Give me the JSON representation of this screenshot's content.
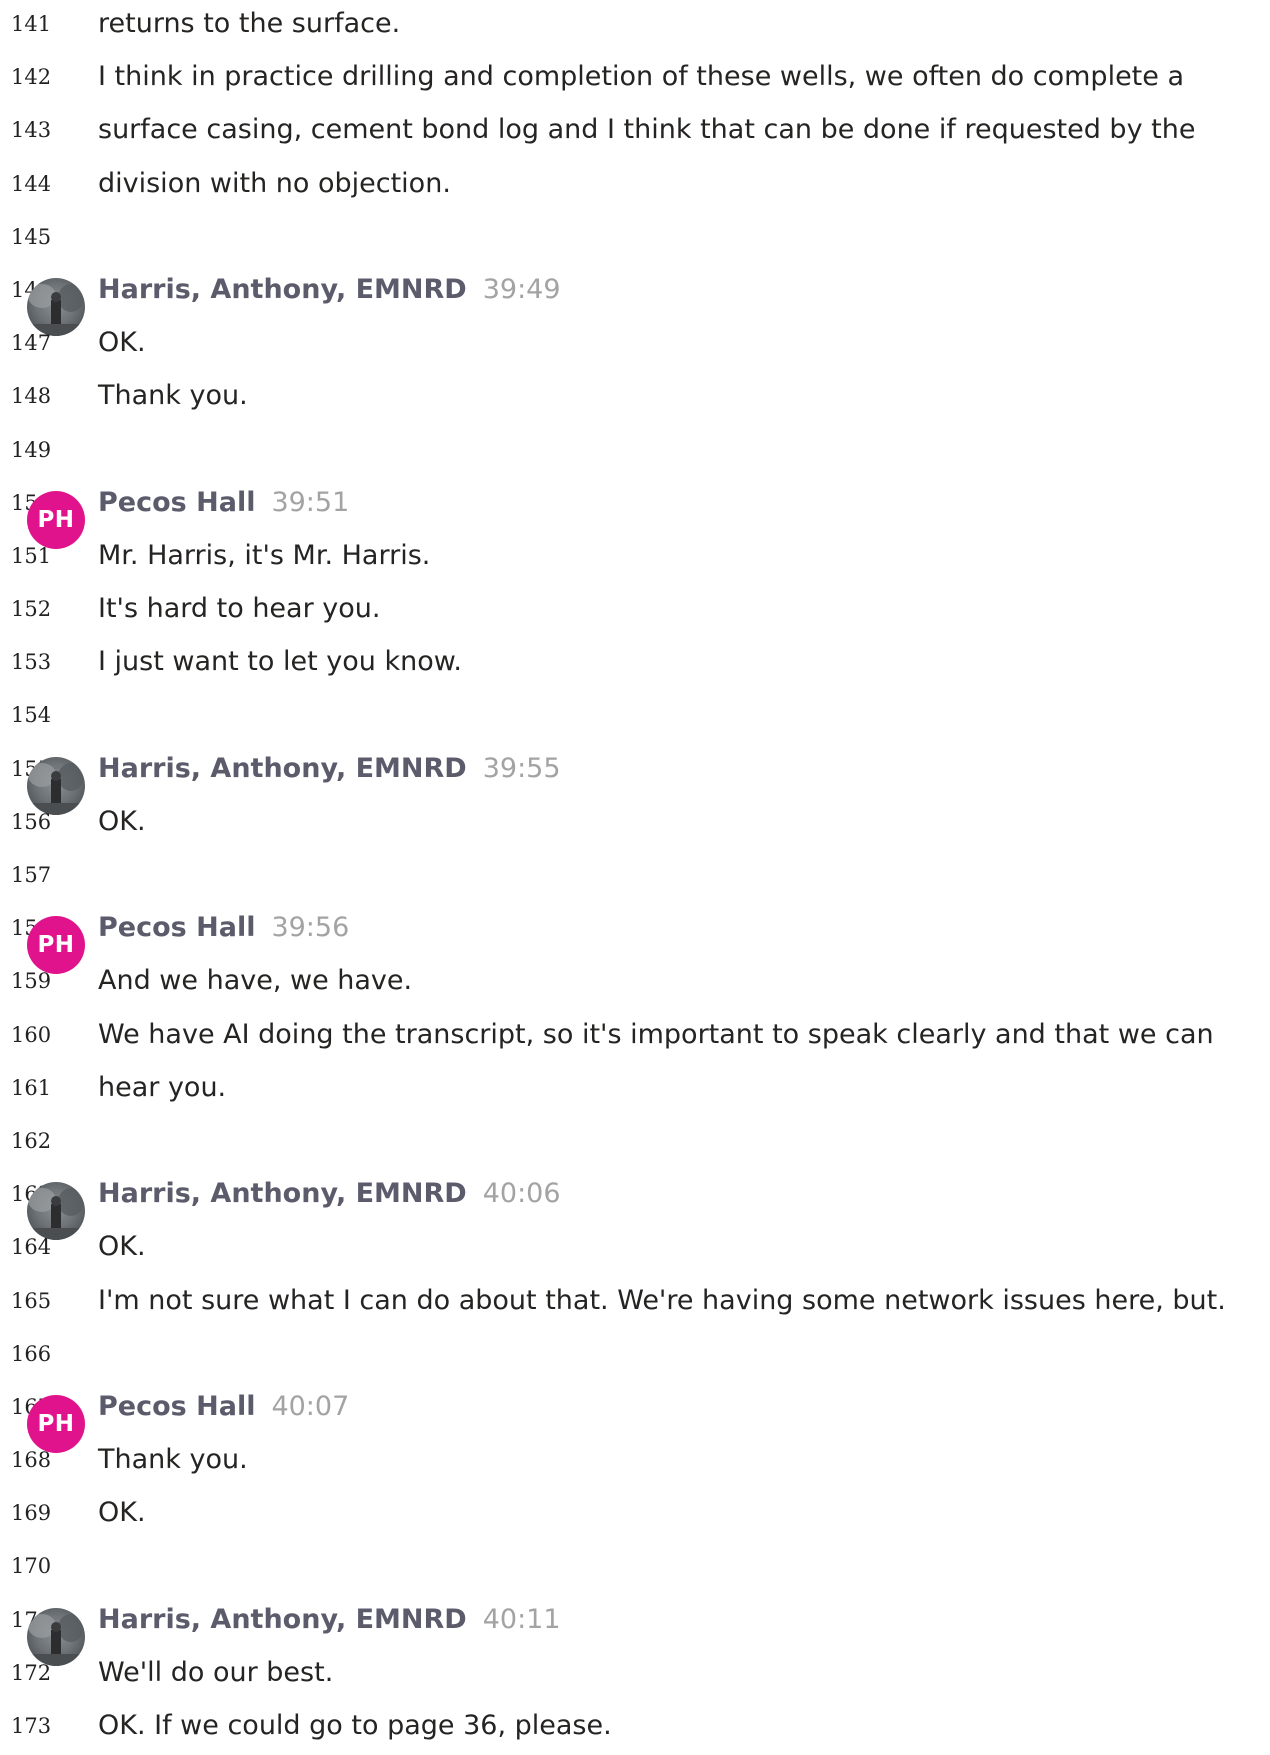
{
  "transcript": {
    "rows": [
      {
        "line": "141",
        "text": "returns to the surface."
      },
      {
        "line": "142",
        "text": "I think in practice drilling and completion of these wells, we often do complete a"
      },
      {
        "line": "143",
        "text": "surface casing, cement bond log and I think that can be done if requested by the"
      },
      {
        "line": "144",
        "text": "division with no objection."
      },
      {
        "line": "145",
        "text": ""
      },
      {
        "line": "146",
        "speaker": "Harris, Anthony, EMNRD",
        "time": "39:49",
        "avatar": "photo"
      },
      {
        "line": "147",
        "text": "OK."
      },
      {
        "line": "148",
        "text": "Thank you."
      },
      {
        "line": "149",
        "text": ""
      },
      {
        "line": "150",
        "speaker": "Pecos Hall",
        "time": "39:51",
        "avatar": "initials",
        "initials": "PH"
      },
      {
        "line": "151",
        "text": "Mr. Harris, it's Mr. Harris."
      },
      {
        "line": "152",
        "text": "It's hard to hear you."
      },
      {
        "line": "153",
        "text": "I just want to let you know."
      },
      {
        "line": "154",
        "text": ""
      },
      {
        "line": "155",
        "speaker": "Harris, Anthony, EMNRD",
        "time": "39:55",
        "avatar": "photo"
      },
      {
        "line": "156",
        "text": "OK."
      },
      {
        "line": "157",
        "text": ""
      },
      {
        "line": "158",
        "speaker": "Pecos Hall",
        "time": "39:56",
        "avatar": "initials",
        "initials": "PH"
      },
      {
        "line": "159",
        "text": "And we have, we have."
      },
      {
        "line": "160",
        "text": "We have AI doing the transcript, so it's important to speak clearly and that we can"
      },
      {
        "line": "161",
        "text": "hear you."
      },
      {
        "line": "162",
        "text": ""
      },
      {
        "line": "163",
        "speaker": "Harris, Anthony, EMNRD",
        "time": "40:06",
        "avatar": "photo"
      },
      {
        "line": "164",
        "text": "OK."
      },
      {
        "line": "165",
        "text": "I'm not sure what I can do about that. We're having some network issues here, but."
      },
      {
        "line": "166",
        "text": ""
      },
      {
        "line": "167",
        "speaker": "Pecos Hall",
        "time": "40:07",
        "avatar": "initials",
        "initials": "PH"
      },
      {
        "line": "168",
        "text": "Thank you."
      },
      {
        "line": "169",
        "text": "OK."
      },
      {
        "line": "170",
        "text": ""
      },
      {
        "line": "171",
        "speaker": "Harris, Anthony, EMNRD",
        "time": "40:11",
        "avatar": "photo"
      },
      {
        "line": "172",
        "text": "We'll do our best."
      },
      {
        "line": "173",
        "text": "OK. If we could go to page 36, please."
      }
    ]
  }
}
